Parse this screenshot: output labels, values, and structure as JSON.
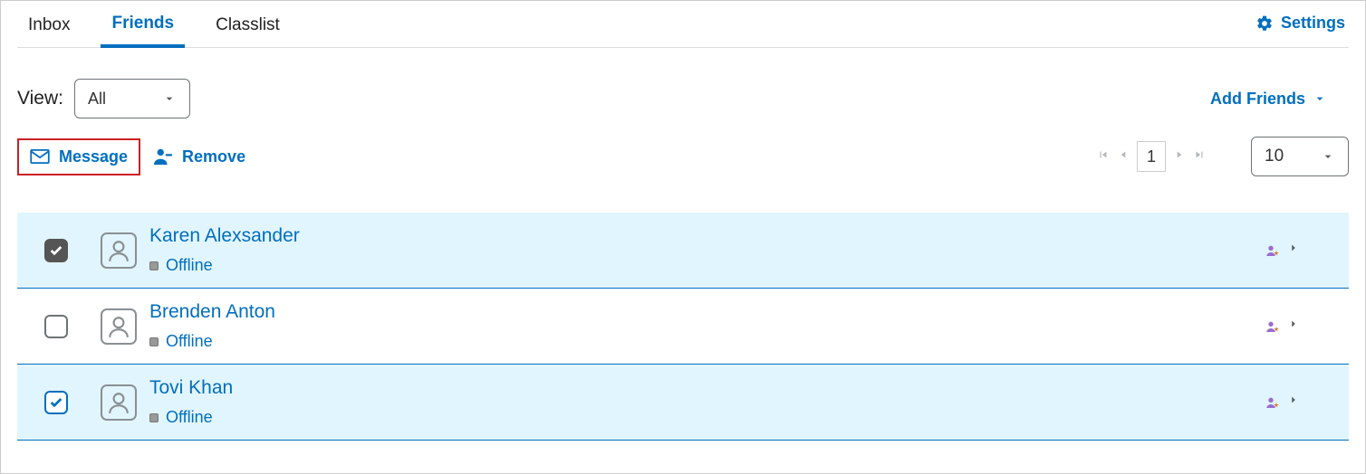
{
  "tabs": {
    "inbox": "Inbox",
    "friends": "Friends",
    "classlist": "Classlist"
  },
  "settings_label": "Settings",
  "view": {
    "label": "View:",
    "selected": "All"
  },
  "add_friends_label": "Add Friends",
  "actions": {
    "message": "Message",
    "remove": "Remove"
  },
  "pager": {
    "page": "1",
    "per_page": "10"
  },
  "friends": [
    {
      "name": "Karen Alexsander",
      "status": "Offline",
      "checked": true,
      "check_style": "dark"
    },
    {
      "name": "Brenden Anton",
      "status": "Offline",
      "checked": false
    },
    {
      "name": "Tovi Khan",
      "status": "Offline",
      "checked": true,
      "check_style": "blue"
    }
  ]
}
